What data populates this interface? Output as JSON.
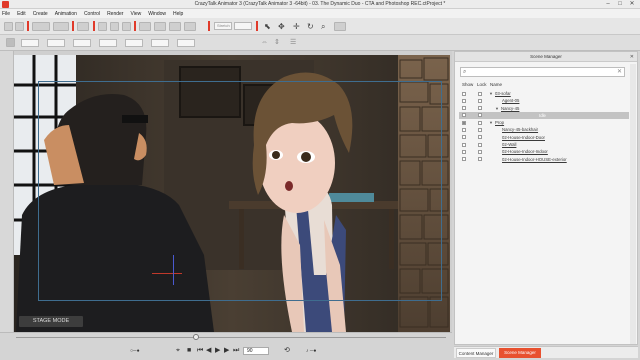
{
  "window": {
    "title": "CrazyTalk Animator 3  (CrazyTalk Animator 3 -64bit) - 03. The Dynamic Duo - CTA and Photoshop REC.ctProject *",
    "controls": [
      "–",
      "□",
      "✕"
    ]
  },
  "menu": [
    "File",
    "Edit",
    "Create",
    "Animation",
    "Control",
    "Render",
    "View",
    "Window",
    "Help"
  ],
  "toolbar": {
    "stretch_placeholder": "Stretch",
    "fields_row1": [
      "",
      "",
      ""
    ],
    "fields_row2": [
      "",
      "",
      "",
      "",
      "",
      "",
      ""
    ]
  },
  "stage": {
    "mode_label": "STAGE MODE"
  },
  "playback": {
    "frame": "90",
    "icons": [
      "target-icon",
      "stop-icon",
      "prev-key-icon",
      "prev-frame-icon",
      "play-icon",
      "next-frame-icon",
      "next-key-icon",
      "loop-icon",
      "volume-icon"
    ]
  },
  "scene_manager": {
    "title": "Scene Manager",
    "close": "✕",
    "search_placeholder": "",
    "columns": {
      "show": "Show",
      "lock": "Lock",
      "name": "Name"
    },
    "rows": [
      {
        "name": "03-sofar",
        "indent": 0,
        "arrow": "▼",
        "show": false,
        "lock": false,
        "selected": false
      },
      {
        "name": "Agent-05",
        "indent": 1,
        "arrow": "",
        "show": false,
        "lock": false,
        "selected": false
      },
      {
        "name": "Nancy-45",
        "indent": 1,
        "arrow": "▼",
        "show": false,
        "lock": false,
        "selected": false
      },
      {
        "name": "Idle",
        "indent": 2,
        "arrow": "",
        "show": false,
        "lock": false,
        "selected": true
      },
      {
        "name": "Prop",
        "indent": 0,
        "arrow": "▼",
        "show": true,
        "lock": false,
        "selected": false
      },
      {
        "name": "Nancy-45-backhair",
        "indent": 1,
        "arrow": "",
        "show": false,
        "lock": false,
        "selected": false
      },
      {
        "name": "02-House-Indoor-Door",
        "indent": 1,
        "arrow": "",
        "show": false,
        "lock": false,
        "selected": false
      },
      {
        "name": "02-Wall",
        "indent": 1,
        "arrow": "",
        "show": false,
        "lock": false,
        "selected": false
      },
      {
        "name": "02-House-Indoor-Indoor",
        "indent": 1,
        "arrow": "",
        "show": false,
        "lock": false,
        "selected": false
      },
      {
        "name": "02-House-Indoor-HOUSE-exterior",
        "indent": 1,
        "arrow": "",
        "show": false,
        "lock": false,
        "selected": false
      }
    ]
  },
  "bottom_tabs": [
    "Content Manager",
    "Scene Manager"
  ],
  "colors": {
    "accent": "#e8512f",
    "stage_bg": "#2f2a24"
  }
}
